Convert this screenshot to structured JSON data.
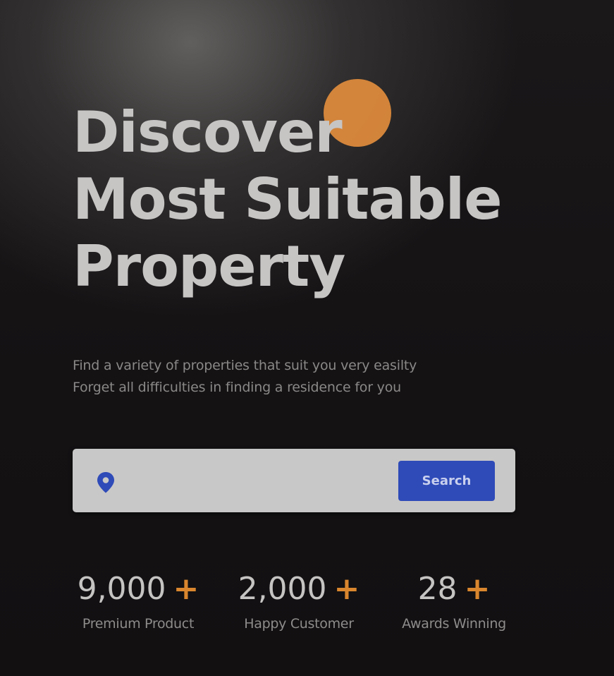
{
  "hero": {
    "title_lines": [
      "Discover",
      "Most Suitable",
      "Property"
    ],
    "subtitle_lines": [
      "Find a variety of properties that suit you very easilty",
      "Forget all difficulties in finding a residence for you"
    ]
  },
  "search": {
    "input_value": "",
    "placeholder": "",
    "button_label": "Search",
    "icon": "location-pin-icon"
  },
  "stats": [
    {
      "value": "9,000",
      "suffix": "+",
      "label": "Premium Product"
    },
    {
      "value": "2,000",
      "suffix": "+",
      "label": "Happy Customer"
    },
    {
      "value": "28",
      "suffix": "+",
      "label": "Awards Winning"
    }
  ],
  "colors": {
    "background": "#121011",
    "accent_orange": "#e08c3c",
    "button_blue": "#2f4bb8",
    "title_text": "#c7c5c4",
    "muted_text": "#8a8887"
  }
}
